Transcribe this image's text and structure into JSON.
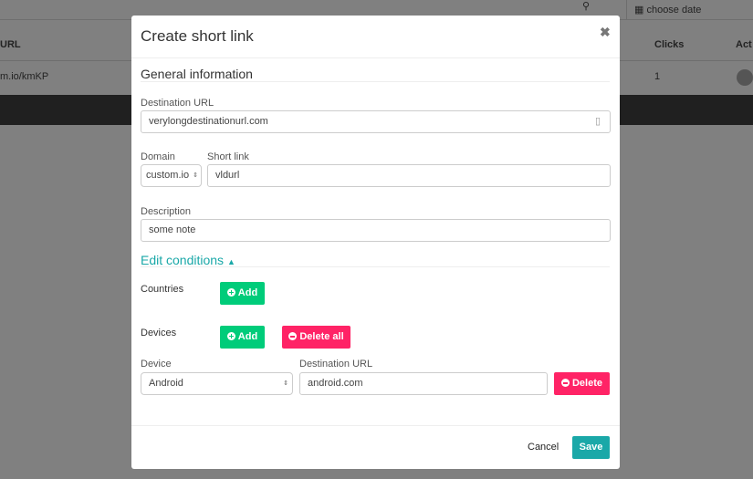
{
  "background": {
    "date_placeholder": "choose date",
    "col_url": "URL",
    "col_clicks": "Clicks",
    "col_actions": "Act",
    "row_url": "m.io/kmKP",
    "row_clicks": "1"
  },
  "modal": {
    "title": "Create short link",
    "general_heading": "General information",
    "destination_label": "Destination URL",
    "destination_value": "verylongdestinationurl.com",
    "domain_label": "Domain",
    "domain_value": "custom.io",
    "shortlink_label": "Short link",
    "shortlink_value": "vldurl",
    "description_label": "Description",
    "description_value": "some note",
    "conditions_heading": "Edit conditions",
    "countries_label": "Countries",
    "add_label": "Add",
    "devices_label": "Devices",
    "delete_all_label": "Delete all",
    "device_label": "Device",
    "device_value": "Android",
    "cond_url_label": "Destination URL",
    "cond_url_value": "android.com",
    "delete_label": "Delete",
    "cancel_label": "Cancel",
    "save_label": "Save"
  },
  "colors": {
    "accent": "#1aa8a8",
    "green": "#00cc7a",
    "red": "#ff2366"
  }
}
